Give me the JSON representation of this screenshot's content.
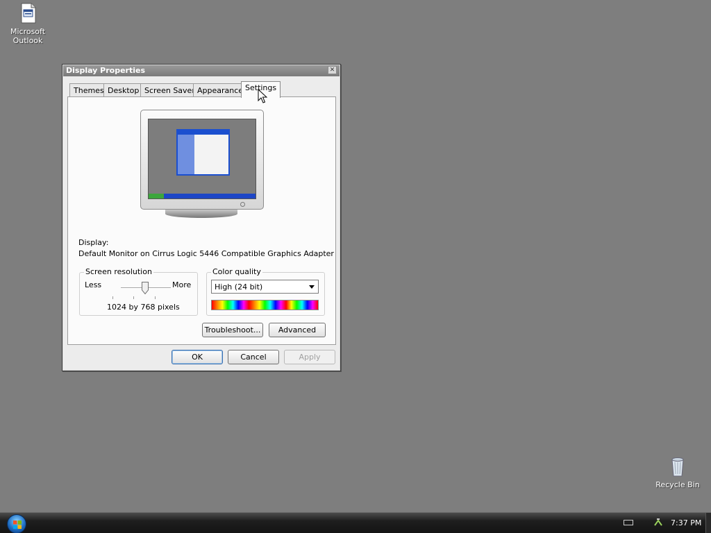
{
  "desktop": {
    "icons": [
      {
        "label": "Microsoft Outlook"
      },
      {
        "label": "Recycle Bin"
      }
    ]
  },
  "dialog": {
    "title": "Display Properties",
    "tabs": [
      "Themes",
      "Desktop",
      "Screen Saver",
      "Appearance",
      "Settings"
    ],
    "active_tab": "Settings",
    "display_label": "Display:",
    "display_value": "Default Monitor on Cirrus Logic 5446 Compatible Graphics Adapter",
    "resolution": {
      "group_title": "Screen resolution",
      "less": "Less",
      "more": "More",
      "value_text": "1024 by 768 pixels"
    },
    "color_quality": {
      "group_title": "Color quality",
      "selected": "High (24 bit)"
    },
    "buttons": {
      "troubleshoot": "Troubleshoot...",
      "advanced": "Advanced",
      "ok": "OK",
      "cancel": "Cancel",
      "apply": "Apply"
    }
  },
  "taskbar": {
    "clock": "7:37 PM"
  },
  "colors": {
    "desktop_bg": "#7e7e7e",
    "dialog_bg": "#ececec",
    "panel_bg": "#fbfbfb",
    "taskbar_bg": "#1e1e1e"
  }
}
